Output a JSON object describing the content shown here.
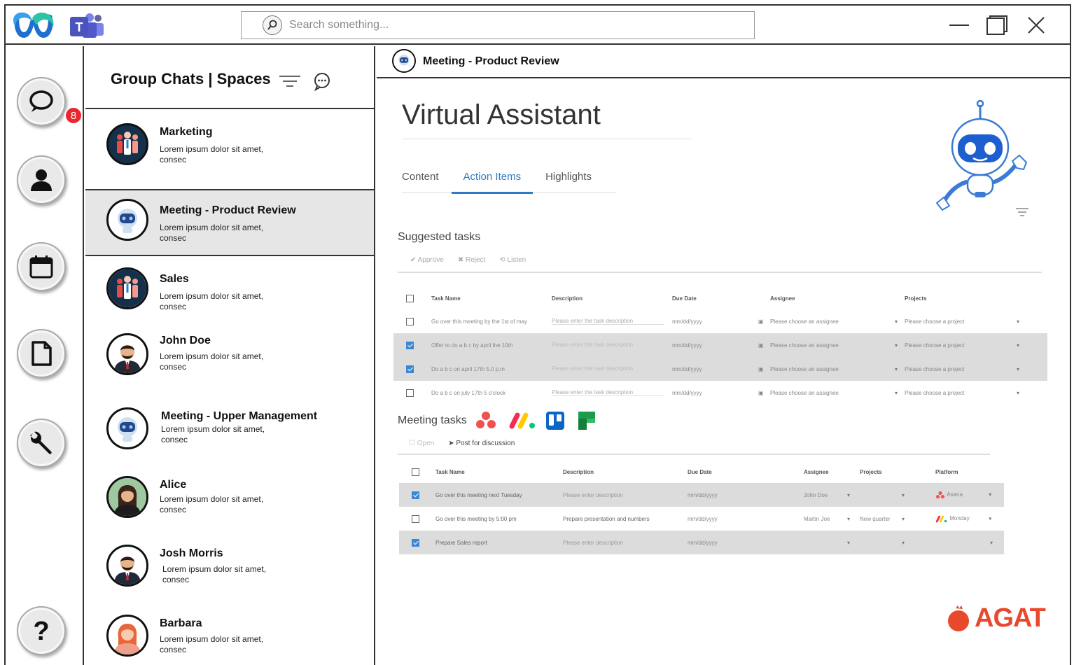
{
  "titlebar": {
    "search_placeholder": "Search something..."
  },
  "rail": {
    "chat_badge": "8"
  },
  "chatlist": {
    "title": "Group Chats | Spaces",
    "items": [
      {
        "name": "Marketing",
        "preview": "Lorem ipsum dolor sit amet, consec"
      },
      {
        "name": "Meeting - Product Review",
        "preview": "Lorem ipsum dolor sit amet, consec"
      },
      {
        "name": "Sales",
        "preview": "Lorem ipsum dolor sit amet, consec"
      },
      {
        "name": "John Doe",
        "preview": "Lorem ipsum dolor sit amet, consec"
      },
      {
        "name": "Meeting - Upper Management",
        "preview": "Lorem ipsum dolor sit amet, consec"
      },
      {
        "name": "Alice",
        "preview": "Lorem ipsum dolor sit amet, consec"
      },
      {
        "name": "Josh Morris",
        "preview": "Lorem ipsum dolor sit amet, consec"
      },
      {
        "name": "Barbara",
        "preview": "Lorem ipsum dolor sit amet, consec"
      }
    ]
  },
  "main": {
    "header_title": "Meeting - Product Review",
    "title": "Virtual Assistant",
    "tabs": [
      "Content",
      "Action Items",
      "Highlights"
    ],
    "active_tab": "Action Items",
    "suggested": {
      "title": "Suggested tasks",
      "actions": [
        "✔ Approve",
        "✖ Reject",
        "⟲ Listen"
      ],
      "headers": [
        "Task Name",
        "Description",
        "Due Date",
        "Assignee",
        "Projects"
      ],
      "rows": [
        {
          "checked": false,
          "task": "Go over this meeting by the 1st of may",
          "desc": "Please enter the task description",
          "due": "mm/dd/yyyy",
          "assignee": "Please choose an assignee",
          "project": "Please choose a project"
        },
        {
          "checked": true,
          "task": "Offer to do a b c by april the 10th",
          "desc": "Please enter the task description",
          "due": "mm/dd/yyyy",
          "assignee": "Please choose an assignee",
          "project": "Please choose a project"
        },
        {
          "checked": true,
          "task": "Do a b c on april 17th 5.0 p.m",
          "desc": "Please enter the task description",
          "due": "mm/dd/yyyy",
          "assignee": "Please choose an assignee",
          "project": "Please choose a project"
        },
        {
          "checked": false,
          "task": "Do a b c on july 17th 5 o'clock",
          "desc": "Please enter the task description",
          "due": "mm/dd/yyyy",
          "assignee": "Please choose an assignee",
          "project": "Please choose a project"
        }
      ]
    },
    "meeting": {
      "title": "Meeting tasks",
      "actions": [
        "☐ Open",
        "➤ Post for discussion"
      ],
      "headers": [
        "Task Name",
        "Description",
        "Due Date",
        "Assignee",
        "Projects",
        "Platform"
      ],
      "rows": [
        {
          "checked": true,
          "task": "Go over this meeting next Tuesday",
          "desc": "Please enter description",
          "due": "mm/dd/yyyy",
          "assignee": "John Doe",
          "project": "",
          "platform": "Asana"
        },
        {
          "checked": false,
          "task": "Go over this meeting by 5:00 pm",
          "desc": "Prepare presentation and numbers",
          "due": "mm/dd/yyyy",
          "assignee": "Martin Joe",
          "project": "New quarter",
          "platform": "Monday"
        },
        {
          "checked": true,
          "task": "Prepare Sales report",
          "desc": "Please enter description",
          "due": "mm/dd/yyyy",
          "assignee": "",
          "project": "",
          "platform": ""
        }
      ]
    },
    "brand": "AGAT"
  },
  "colors": {
    "accent": "#2f7bc1",
    "badge": "#e8282f",
    "brand": "#e8482c"
  }
}
